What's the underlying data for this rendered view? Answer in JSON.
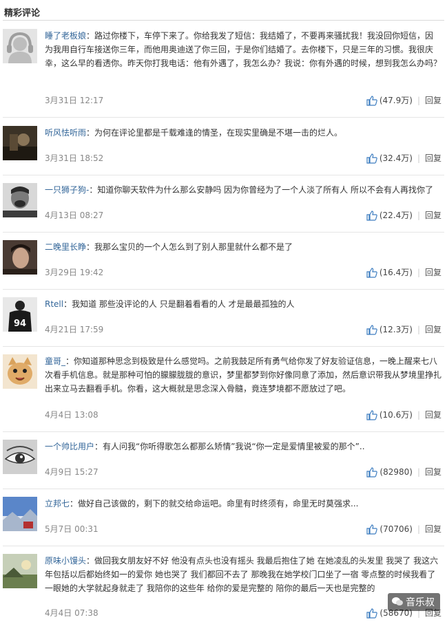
{
  "section_title": "精彩评论",
  "reply_label": "回复",
  "watermark": "音乐叔",
  "comments": [
    {
      "user": "睡了老板娘",
      "text": "：路过你楼下，车停下来了。你给我发了短信：我结婚了，不要再来骚扰我！我没回你短信，因为我用自行车接送你三年，而他用奥迪送了你三回，于是你们结婚了。去你楼下，只是三年的习惯。我很庆幸，这么早的看透你。昨天你打我电话：他有外遇了，我怎么办？我说：你有外遇的时候，想到我怎么办吗？",
      "time": "3月31日 12:17",
      "likes": "(47.9万)",
      "avatar": "headphones-avatar"
    },
    {
      "user": "听风怯听雨",
      "text": "：为何在评论里都是千载难逢的情圣，在现实里确是不堪一击的烂人。",
      "time": "3月31日 18:52",
      "likes": "(32.4万)",
      "avatar": "dark-photo-avatar"
    },
    {
      "user": "一只狮子狗-",
      "text": "：知道你聊天软件为什么那么安静吗 因为你曾经为了一个人淡了所有人 所以不会有人再找你了",
      "time": "4月13日 08:27",
      "likes": "(22.4万)",
      "avatar": "laughing-man-avatar"
    },
    {
      "user": "二晚里长睁",
      "text": "：我那么宝贝的一个人怎么到了别人那里就什么都不是了",
      "time": "3月29日 19:42",
      "likes": "(16.4万)",
      "avatar": "portrait-avatar"
    },
    {
      "user": "Rtell",
      "text": "：我知道 那些没评论的人 只是翻着看看的人 才是最最孤独的人",
      "time": "4月21日 17:59",
      "likes": "(12.3万)",
      "avatar": "jersey-94-avatar",
      "jersey": "94"
    },
    {
      "user": "童哥_",
      "text": "：你知道那种思念到极致是什么感觉吗。之前我鼓足所有勇气给你发了好友验证信息，一晚上醒来七八次看手机信息。就是那种可怕的朦朦胧胧的意识，梦里都梦到你好像同意了添加，然后意识带我从梦境里挣扎出来立马去翻看手机。你看，这大概就是思念深入骨髓，竟连梦境都不愿放过了吧。",
      "time": "4月4日 13:08",
      "likes": "(10.6万)",
      "avatar": "cat-avatar"
    },
    {
      "user": "一个帅比用户",
      "text": "：有人问我“你听得歌怎么都那么矫情”我说“你一定是爱情里被爱的那个”..",
      "time": "4月9日 15:27",
      "likes": "(82980)",
      "avatar": "eye-avatar"
    },
    {
      "user": "立邦七",
      "text": "：做好自己该做的，剩下的就交给命运吧。命里有时终须有，命里无时莫强求...",
      "time": "5月7日 00:31",
      "likes": "(70706)",
      "avatar": "sky-avatar"
    },
    {
      "user": "原味小馒头",
      "text": "：做回我女朋友好不好 他没有点头也没有摇头 我最后抱住了她 在她凌乱的头发里 我哭了 我这六年包括以后都始终如一的爱你 她也哭了 我们都回不去了 那晚我在她学校门口坐了一宿 零点整的时候我看了一眼她的大学就起身就走了 我陪你的这些年 给你的爱是完整的 陪你的最后一天也是完整的",
      "time": "4月4日 07:38",
      "likes": "(58670)",
      "avatar": "landscape-avatar"
    }
  ]
}
